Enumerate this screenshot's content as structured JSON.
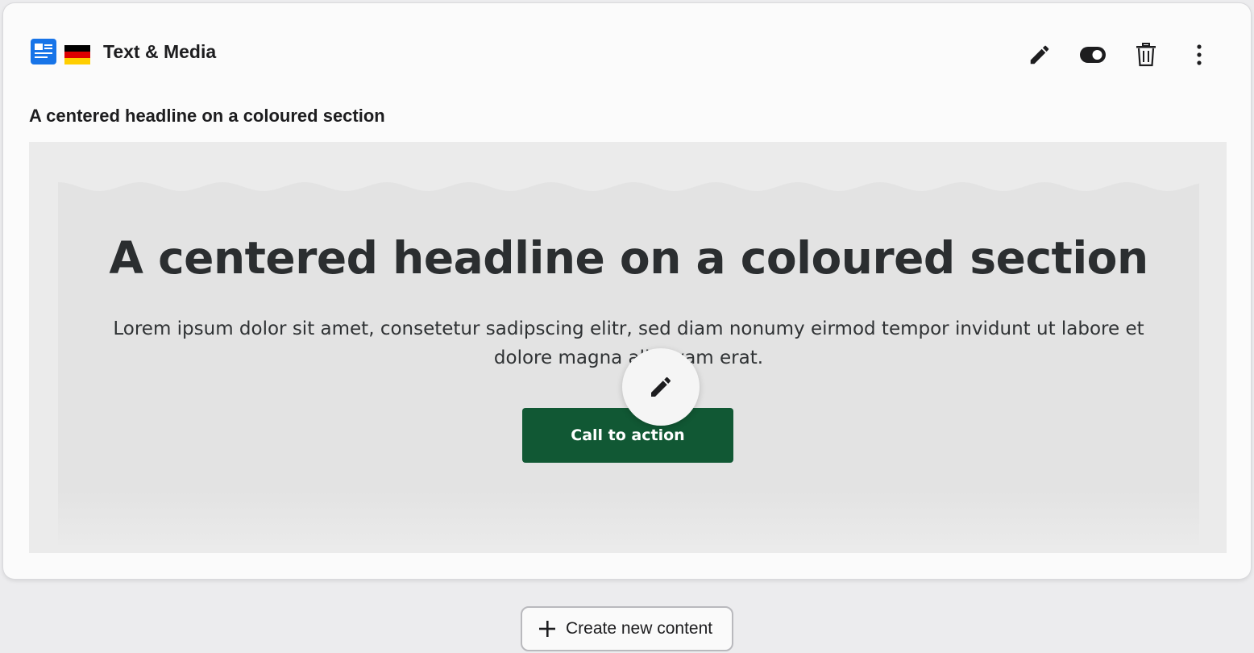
{
  "card": {
    "title": "Text & Media",
    "content_type_icon": "text-media-icon",
    "language_flag": "flag-de-icon",
    "actions": [
      {
        "name": "edit-button",
        "icon": "pencil-icon"
      },
      {
        "name": "visibility-toggle",
        "icon": "toggle-icon"
      },
      {
        "name": "delete-button",
        "icon": "trash-icon"
      },
      {
        "name": "more-button",
        "icon": "more-vertical-icon"
      }
    ],
    "subtitle": "A centered headline on a coloured section"
  },
  "preview": {
    "headline": "A centered headline on a coloured section",
    "body": "Lorem ipsum dolor sit amet, consetetur sadipscing elitr, sed diam nonumy eirmod tempor invidunt ut labore et dolore magna aliquyam erat.",
    "cta_label": "Call to action",
    "edit_overlay_icon": "pencil-icon"
  },
  "footer": {
    "create_label": "Create new content",
    "create_icon": "plus-icon"
  },
  "colors": {
    "accent": "#1774e8",
    "cta_background": "#115834",
    "section_background": "#e3e3e3",
    "page_background": "#ececee"
  }
}
